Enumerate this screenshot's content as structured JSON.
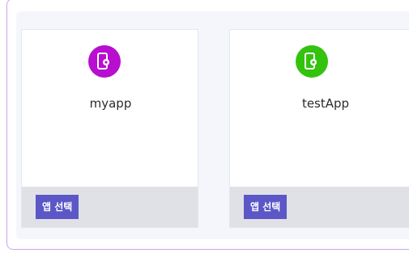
{
  "apps": [
    {
      "name": "myapp",
      "select_label": "앱 선택",
      "icon": "mobile-settings-icon",
      "icon_color": "#b80ed0"
    },
    {
      "name": "testApp",
      "select_label": "앱 선택",
      "icon": "mobile-settings-icon",
      "icon_color": "#33c30f"
    }
  ],
  "colors": {
    "panel_bg": "#f4f6fb",
    "button_bg": "#5b57c7",
    "footer_bg": "#dfe1e6",
    "frame_border": "#c9a7e8"
  }
}
